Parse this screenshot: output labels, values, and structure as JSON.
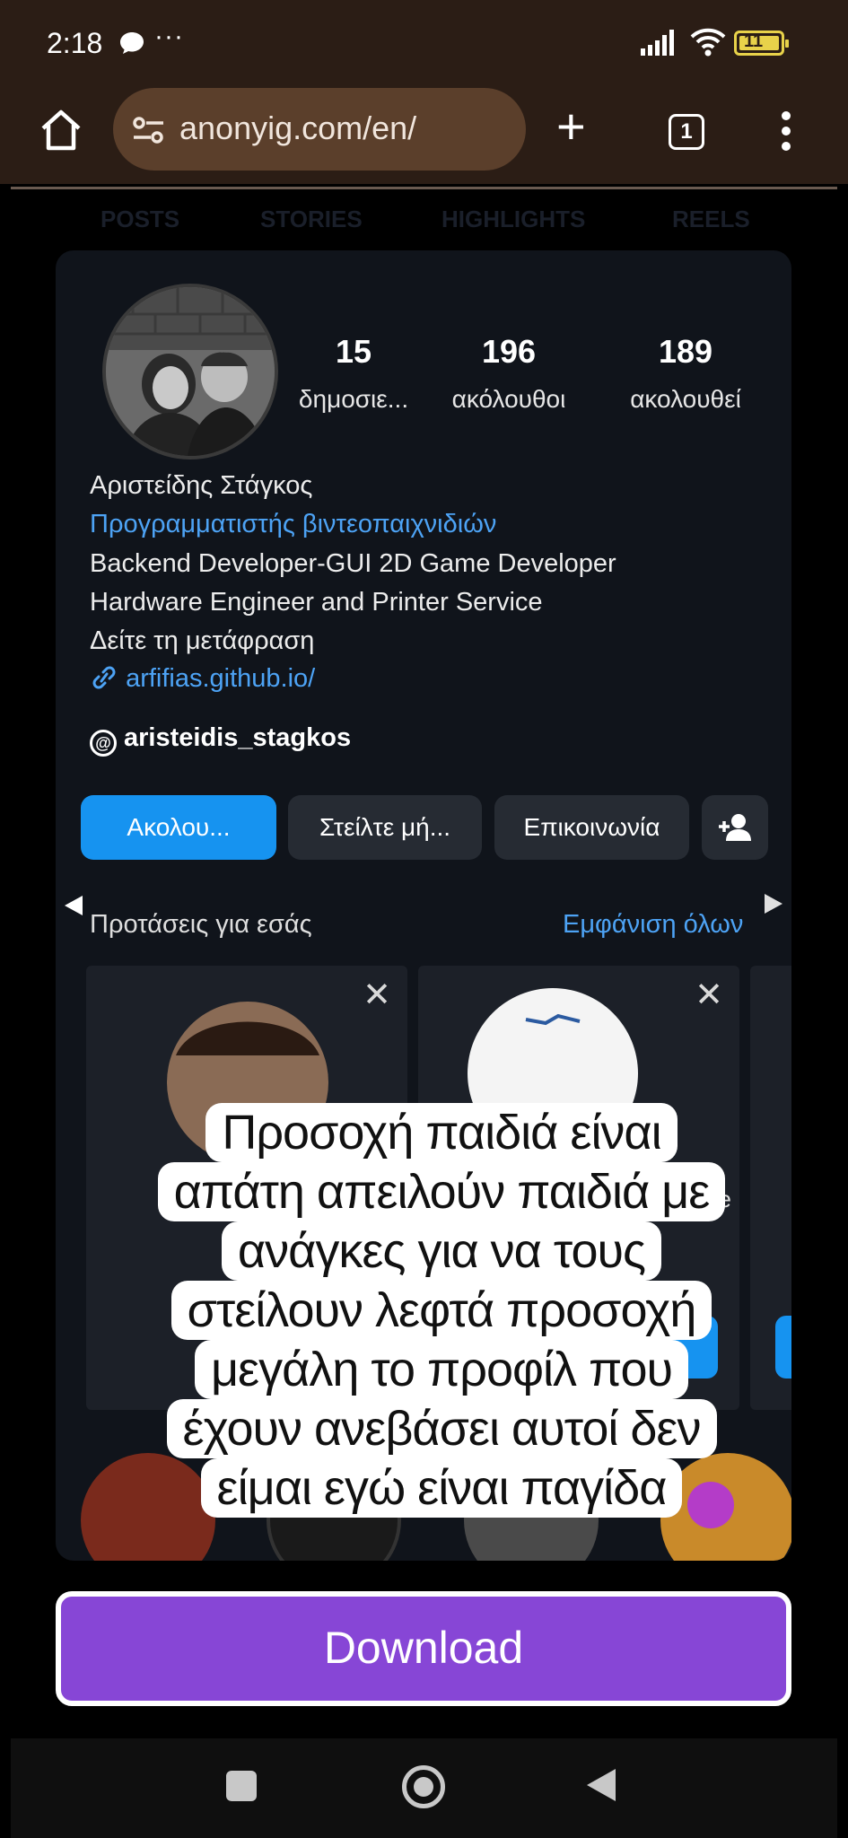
{
  "status_bar": {
    "time": "2:18",
    "more": "···",
    "battery": "11",
    "icons": [
      "chat-icon",
      "signal-icon",
      "wifi-icon",
      "battery-icon"
    ]
  },
  "browser": {
    "url": "anonyig.com/en/",
    "tab_count": "1",
    "icons": [
      "home-icon",
      "site-settings-icon",
      "plus-icon",
      "tabs-icon",
      "menu-dots-icon"
    ]
  },
  "page_tabs": [
    "POSTS",
    "STORIES",
    "HIGHLIGHTS",
    "REELS"
  ],
  "profile": {
    "stats": [
      {
        "value": "15",
        "label": "δημοσιε..."
      },
      {
        "value": "196",
        "label": "ακόλουθοι"
      },
      {
        "value": "189",
        "label": "ακολουθεί"
      }
    ],
    "name": "Αριστείδης Στάγκος",
    "category": "Προγραμματιστής βιντεοπαιχνιδιών",
    "bio_line1": "Backend Developer-GUI 2D Game Developer",
    "bio_line2": "Hardware Engineer and Printer Service",
    "see_translation": "Δείτε τη μετάφραση",
    "link": "arfifias.github.io/",
    "threads_handle": "aristeidis_stagkos"
  },
  "actions": {
    "follow": "Ακολου...",
    "message": "Στείλτε μή...",
    "contact": "Επικοινωνία"
  },
  "suggestions": {
    "title": "Προτάσεις για εσάς",
    "see_all": "Εμφάνιση όλων",
    "close": "✕",
    "partial_text": "ae",
    "partial_button": "ε"
  },
  "overlay_text": [
    "Προσοχή παιδιά είναι",
    "απάτη απειλούν παιδιά με",
    "ανάγκες για να τους",
    "στείλουν λεφτά προσοχή",
    "μεγάλη το προφίλ που",
    "έχουν ανεβάσει αυτοί δεν",
    "είμαι εγώ είναι παγίδα"
  ],
  "download_label": "Download",
  "colors": {
    "accent_blue": "#1693f0",
    "link_blue": "#4da3f5",
    "download_purple": "#8746d6",
    "browser_bar": "#2b1d15"
  }
}
